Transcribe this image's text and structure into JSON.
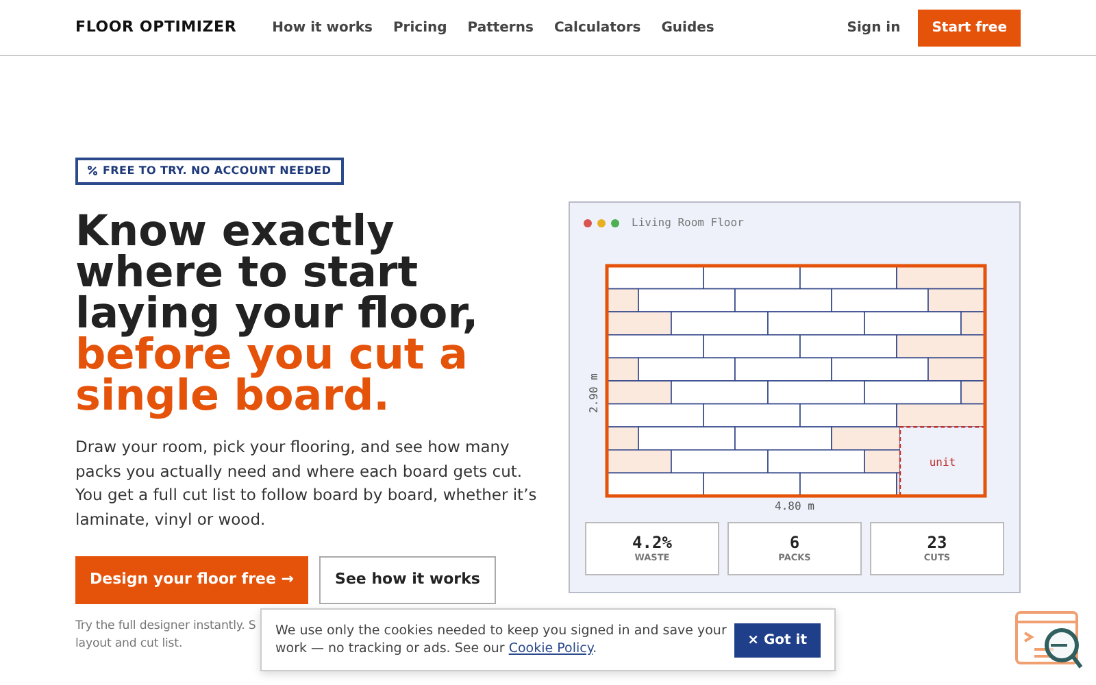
{
  "nav": {
    "brand": "FLOOR OPTIMIZER",
    "links": [
      "How it works",
      "Pricing",
      "Patterns",
      "Calculators",
      "Guides"
    ],
    "sign_in": "Sign in",
    "cta": "Start free"
  },
  "hero": {
    "badge": "FREE TO TRY. NO ACCOUNT NEEDED",
    "headline": "Know exactly where to start laying your floor,",
    "headline_accent": "before you cut a single board.",
    "lead": "Draw your room, pick your flooring, and see how many packs you actually need and where each board gets cut. You get a full cut list to follow board by board, whether it’s laminate, vinyl or wood.",
    "primary_button": "Design your floor free →",
    "secondary_button": "See how it works",
    "note_lines": [
      "Try the full designer instantly. S",
      "layout and cut list."
    ]
  },
  "preview": {
    "title": "Living Room Floor",
    "height_label": "2.90 m",
    "width_label": "4.80 m",
    "obstacle_label": "unit",
    "stats": [
      {
        "value": "4.2%",
        "label": "WASTE"
      },
      {
        "value": "6",
        "label": "PACKS"
      },
      {
        "value": "23",
        "label": "CUTS"
      }
    ]
  },
  "cookie_banner": {
    "text": "We use only the cookies needed to keep you signed in and save your work — no tracking or ads. See our",
    "link": "Cookie Policy",
    "after_link": ".",
    "button_glyph": "×",
    "button": "Got it"
  }
}
